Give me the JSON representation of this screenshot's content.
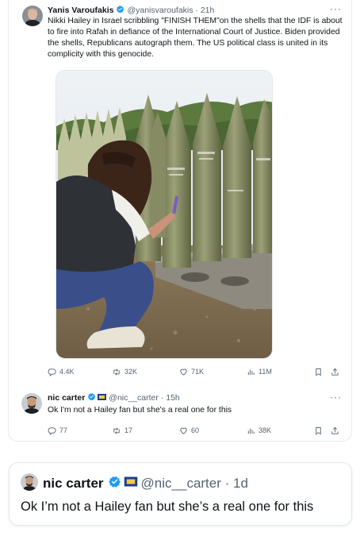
{
  "tweet": {
    "author_name": "Yanis Varoufakis",
    "author_handle": "@yanisvaroufakis",
    "time": "21h",
    "text": "Nikki Hailey in Israel scribbling \"FINISH THEM\"on the shells that the IDF is about to fire into Rafah in defiance of the International Court of Justice. Biden provided the shells, Republicans autograph them. The US political class is united in its complicity with this genocide.",
    "replies": "4.4K",
    "retweets": "32K",
    "likes": "71K",
    "views": "11M"
  },
  "reply": {
    "author_name": "nic carter",
    "author_handle": "@nic__carter",
    "time": "15h",
    "text": "Ok I'm not a Hailey fan but she's a real one for this",
    "replies": "77",
    "retweets": "17",
    "likes": "60",
    "views": "38K"
  },
  "quote": {
    "author_name": "nic carter",
    "author_handle": "@nic__carter",
    "time": "1d",
    "text": "Ok I’m not a Hailey fan but she’s a real one for this"
  },
  "colors": {
    "text": "#0f1419",
    "muted": "#536471",
    "verified": "#1d9bf0",
    "border": "#e1e8ed"
  },
  "icons": [
    "reply-icon",
    "retweet-icon",
    "like-icon",
    "views-icon",
    "bookmark-icon",
    "share-icon",
    "verified-icon",
    "more-icon"
  ]
}
